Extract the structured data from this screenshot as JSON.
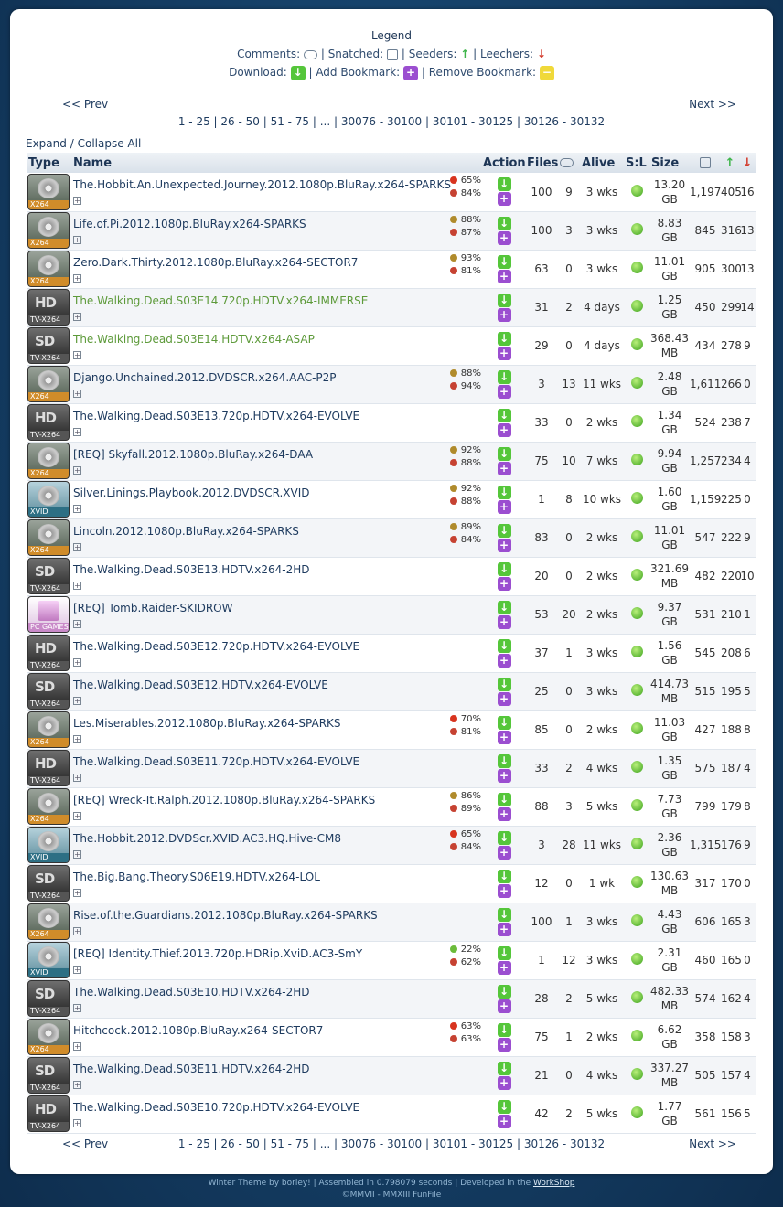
{
  "legend": {
    "title": "Legend",
    "comments": "Comments:",
    "snatched": "Snatched:",
    "seeders": "Seeders:",
    "leechers": "Leechers:",
    "download": "Download:",
    "add_bookmark": "Add Bookmark:",
    "remove_bookmark": "Remove Bookmark:",
    "sep": "|"
  },
  "pager": {
    "prev": "<< Prev",
    "next": "Next >>",
    "pages": [
      "1 - 25",
      "26 - 50",
      "51 - 75",
      "...",
      "30076 - 30100",
      "30101 - 30125",
      "30126 - 30132"
    ]
  },
  "expand": {
    "expand": "Expand",
    "sep": "/",
    "collapse": "Collapse All"
  },
  "columns": {
    "type": "Type",
    "name": "Name",
    "action": "Action",
    "files": "Files",
    "alive": "Alive",
    "sl": "S:L",
    "size": "Size"
  },
  "rows": [
    {
      "type": "x264",
      "name": "The.Hobbit.An.Unexpected.Journey.2012.1080p.BluRay.x264-SPARKS",
      "new": false,
      "r1": "65%",
      "r1i": "tomato",
      "r2": "84%",
      "files": "100",
      "comments": "9",
      "alive": "3 wks",
      "size1": "13.20",
      "size2": "GB",
      "snatched": "1,197",
      "seeders": "405",
      "leechers": "16"
    },
    {
      "type": "x264",
      "name": "Life.of.Pi.2012.1080p.BluRay.x264-SPARKS",
      "new": false,
      "r1": "88%",
      "r1i": "meh",
      "r2": "87%",
      "files": "100",
      "comments": "3",
      "alive": "3 wks",
      "size1": "8.83",
      "size2": "GB",
      "snatched": "845",
      "seeders": "316",
      "leechers": "13"
    },
    {
      "type": "x264",
      "name": "Zero.Dark.Thirty.2012.1080p.BluRay.x264-SECTOR7",
      "new": false,
      "r1": "93%",
      "r1i": "meh",
      "r2": "81%",
      "files": "63",
      "comments": "0",
      "alive": "3 wks",
      "size1": "11.01",
      "size2": "GB",
      "snatched": "905",
      "seeders": "300",
      "leechers": "13"
    },
    {
      "type": "hd",
      "name": "The.Walking.Dead.S03E14.720p.HDTV.x264-IMMERSE",
      "new": true,
      "r1": "",
      "r1i": "",
      "r2": "",
      "files": "31",
      "comments": "2",
      "alive": "4 days",
      "size1": "1.25",
      "size2": "GB",
      "snatched": "450",
      "seeders": "299",
      "leechers": "14"
    },
    {
      "type": "sd",
      "name": "The.Walking.Dead.S03E14.HDTV.x264-ASAP",
      "new": true,
      "r1": "",
      "r1i": "",
      "r2": "",
      "files": "29",
      "comments": "0",
      "alive": "4 days",
      "size1": "368.43",
      "size2": "MB",
      "snatched": "434",
      "seeders": "278",
      "leechers": "9"
    },
    {
      "type": "x264",
      "name": "Django.Unchained.2012.DVDSCR.x264.AAC-P2P",
      "new": false,
      "r1": "88%",
      "r1i": "meh",
      "r2": "94%",
      "files": "3",
      "comments": "13",
      "alive": "11 wks",
      "size1": "2.48",
      "size2": "GB",
      "snatched": "1,611",
      "seeders": "266",
      "leechers": "0"
    },
    {
      "type": "hd",
      "name": "The.Walking.Dead.S03E13.720p.HDTV.x264-EVOLVE",
      "new": false,
      "r1": "",
      "r1i": "",
      "r2": "",
      "files": "33",
      "comments": "0",
      "alive": "2 wks",
      "size1": "1.34",
      "size2": "GB",
      "snatched": "524",
      "seeders": "238",
      "leechers": "7"
    },
    {
      "type": "x264",
      "name": "[REQ] Skyfall.2012.1080p.BluRay.x264-DAA",
      "new": false,
      "r1": "92%",
      "r1i": "meh",
      "r2": "88%",
      "files": "75",
      "comments": "10",
      "alive": "7 wks",
      "size1": "9.94",
      "size2": "GB",
      "snatched": "1,257",
      "seeders": "234",
      "leechers": "4"
    },
    {
      "type": "xvid",
      "name": "Silver.Linings.Playbook.2012.DVDSCR.XVID",
      "new": false,
      "r1": "92%",
      "r1i": "meh",
      "r2": "88%",
      "files": "1",
      "comments": "8",
      "alive": "10 wks",
      "size1": "1.60",
      "size2": "GB",
      "snatched": "1,159",
      "seeders": "225",
      "leechers": "0"
    },
    {
      "type": "x264",
      "name": "Lincoln.2012.1080p.BluRay.x264-SPARKS",
      "new": false,
      "r1": "89%",
      "r1i": "meh",
      "r2": "84%",
      "files": "83",
      "comments": "0",
      "alive": "2 wks",
      "size1": "11.01",
      "size2": "GB",
      "snatched": "547",
      "seeders": "222",
      "leechers": "9"
    },
    {
      "type": "sd",
      "name": "The.Walking.Dead.S03E13.HDTV.x264-2HD",
      "new": false,
      "r1": "",
      "r1i": "",
      "r2": "",
      "files": "20",
      "comments": "0",
      "alive": "2 wks",
      "size1": "321.69",
      "size2": "MB",
      "snatched": "482",
      "seeders": "220",
      "leechers": "10"
    },
    {
      "type": "pc",
      "name": "[REQ] Tomb.Raider-SKIDROW",
      "new": false,
      "r1": "",
      "r1i": "",
      "r2": "",
      "files": "53",
      "comments": "20",
      "alive": "2 wks",
      "size1": "9.37",
      "size2": "GB",
      "snatched": "531",
      "seeders": "210",
      "leechers": "1"
    },
    {
      "type": "hd",
      "name": "The.Walking.Dead.S03E12.720p.HDTV.x264-EVOLVE",
      "new": false,
      "r1": "",
      "r1i": "",
      "r2": "",
      "files": "37",
      "comments": "1",
      "alive": "3 wks",
      "size1": "1.56",
      "size2": "GB",
      "snatched": "545",
      "seeders": "208",
      "leechers": "6"
    },
    {
      "type": "sd",
      "name": "The.Walking.Dead.S03E12.HDTV.x264-EVOLVE",
      "new": false,
      "r1": "",
      "r1i": "",
      "r2": "",
      "files": "25",
      "comments": "0",
      "alive": "3 wks",
      "size1": "414.73",
      "size2": "MB",
      "snatched": "515",
      "seeders": "195",
      "leechers": "5"
    },
    {
      "type": "x264",
      "name": "Les.Miserables.2012.1080p.BluRay.x264-SPARKS",
      "new": false,
      "r1": "70%",
      "r1i": "tomato",
      "r2": "81%",
      "files": "85",
      "comments": "0",
      "alive": "2 wks",
      "size1": "11.03",
      "size2": "GB",
      "snatched": "427",
      "seeders": "188",
      "leechers": "8"
    },
    {
      "type": "hd",
      "name": "The.Walking.Dead.S03E11.720p.HDTV.x264-EVOLVE",
      "new": false,
      "r1": "",
      "r1i": "",
      "r2": "",
      "files": "33",
      "comments": "2",
      "alive": "4 wks",
      "size1": "1.35",
      "size2": "GB",
      "snatched": "575",
      "seeders": "187",
      "leechers": "4"
    },
    {
      "type": "x264",
      "name": "[REQ] Wreck-It.Ralph.2012.1080p.BluRay.x264-SPARKS",
      "new": false,
      "r1": "86%",
      "r1i": "meh",
      "r2": "89%",
      "files": "88",
      "comments": "3",
      "alive": "5 wks",
      "size1": "7.73",
      "size2": "GB",
      "snatched": "799",
      "seeders": "179",
      "leechers": "8"
    },
    {
      "type": "xvid",
      "name": "The.Hobbit.2012.DVDScr.XVID.AC3.HQ.Hive-CM8",
      "new": false,
      "r1": "65%",
      "r1i": "tomato",
      "r2": "84%",
      "files": "3",
      "comments": "28",
      "alive": "11 wks",
      "size1": "2.36",
      "size2": "GB",
      "snatched": "1,315",
      "seeders": "176",
      "leechers": "9"
    },
    {
      "type": "sd",
      "name": "The.Big.Bang.Theory.S06E19.HDTV.x264-LOL",
      "new": false,
      "r1": "",
      "r1i": "",
      "r2": "",
      "files": "12",
      "comments": "0",
      "alive": "1 wk",
      "size1": "130.63",
      "size2": "MB",
      "snatched": "317",
      "seeders": "170",
      "leechers": "0"
    },
    {
      "type": "x264",
      "name": "Rise.of.the.Guardians.2012.1080p.BluRay.x264-SPARKS",
      "new": false,
      "r1": "",
      "r1i": "",
      "r2": "",
      "files": "100",
      "comments": "1",
      "alive": "3 wks",
      "size1": "4.43",
      "size2": "GB",
      "snatched": "606",
      "seeders": "165",
      "leechers": "3"
    },
    {
      "type": "xvid",
      "name": "[REQ] Identity.Thief.2013.720p.HDRip.XviD.AC3-SmY",
      "new": false,
      "r1": "22%",
      "r1i": "green",
      "r2": "62%",
      "files": "1",
      "comments": "12",
      "alive": "3 wks",
      "size1": "2.31",
      "size2": "GB",
      "snatched": "460",
      "seeders": "165",
      "leechers": "0"
    },
    {
      "type": "sd",
      "name": "The.Walking.Dead.S03E10.HDTV.x264-2HD",
      "new": false,
      "r1": "",
      "r1i": "",
      "r2": "",
      "files": "28",
      "comments": "2",
      "alive": "5 wks",
      "size1": "482.33",
      "size2": "MB",
      "snatched": "574",
      "seeders": "162",
      "leechers": "4"
    },
    {
      "type": "x264",
      "name": "Hitchcock.2012.1080p.BluRay.x264-SECTOR7",
      "new": false,
      "r1": "63%",
      "r1i": "tomato",
      "r2": "63%",
      "files": "75",
      "comments": "1",
      "alive": "2 wks",
      "size1": "6.62",
      "size2": "GB",
      "snatched": "358",
      "seeders": "158",
      "leechers": "3"
    },
    {
      "type": "sd",
      "name": "The.Walking.Dead.S03E11.HDTV.x264-2HD",
      "new": false,
      "r1": "",
      "r1i": "",
      "r2": "",
      "files": "21",
      "comments": "0",
      "alive": "4 wks",
      "size1": "337.27",
      "size2": "MB",
      "snatched": "505",
      "seeders": "157",
      "leechers": "4"
    },
    {
      "type": "hd",
      "name": "The.Walking.Dead.S03E10.720p.HDTV.x264-EVOLVE",
      "new": false,
      "r1": "",
      "r1i": "",
      "r2": "",
      "files": "42",
      "comments": "2",
      "alive": "5 wks",
      "size1": "1.77",
      "size2": "GB",
      "snatched": "561",
      "seeders": "156",
      "leechers": "5"
    }
  ],
  "type_labels": {
    "x264": "X264",
    "hd": "TV-X264",
    "sd": "TV-X264",
    "xvid": "XVID",
    "pc": "PC GAMES",
    "hd_big": "HD",
    "sd_big": "SD"
  },
  "footer": {
    "line1_a": "Winter Theme by borley! | Assembled in 0.798079 seconds | Developed in the ",
    "workshop": "WorkShop",
    "line2": "©MMVII - MMXIII FunFile"
  }
}
